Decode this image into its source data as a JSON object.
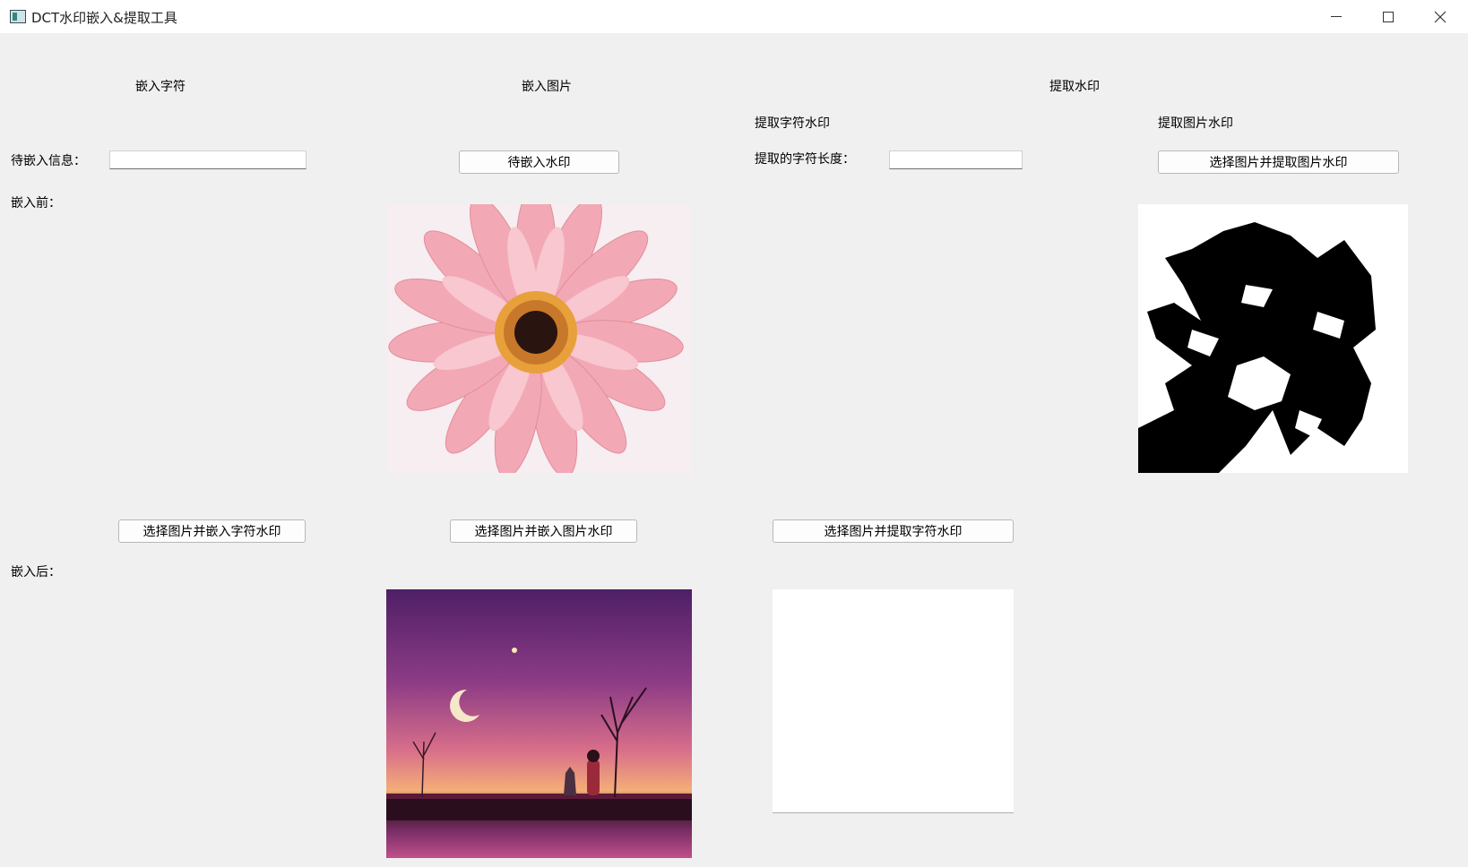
{
  "window": {
    "title": "DCT水印嵌入&提取工具"
  },
  "sections": {
    "embed_text": "嵌入字符",
    "embed_image": "嵌入图片",
    "extract": "提取水印"
  },
  "extract_text": {
    "heading": "提取字符水印",
    "length_label": "提取的字符长度：",
    "length_value": "",
    "button": "选择图片并提取字符水印"
  },
  "extract_image": {
    "heading": "提取图片水印",
    "button": "选择图片并提取图片水印"
  },
  "embed_text": {
    "info_label": "待嵌入信息：",
    "info_value": "",
    "before_label": "嵌入前：",
    "after_label": "嵌入后：",
    "button": "选择图片并嵌入字符水印"
  },
  "embed_image": {
    "watermark_button": "待嵌入水印",
    "button": "选择图片并嵌入图片水印"
  },
  "icons": {
    "app": "app-icon",
    "minimize": "minimize-icon",
    "maximize": "maximize-icon",
    "close": "close-icon"
  }
}
